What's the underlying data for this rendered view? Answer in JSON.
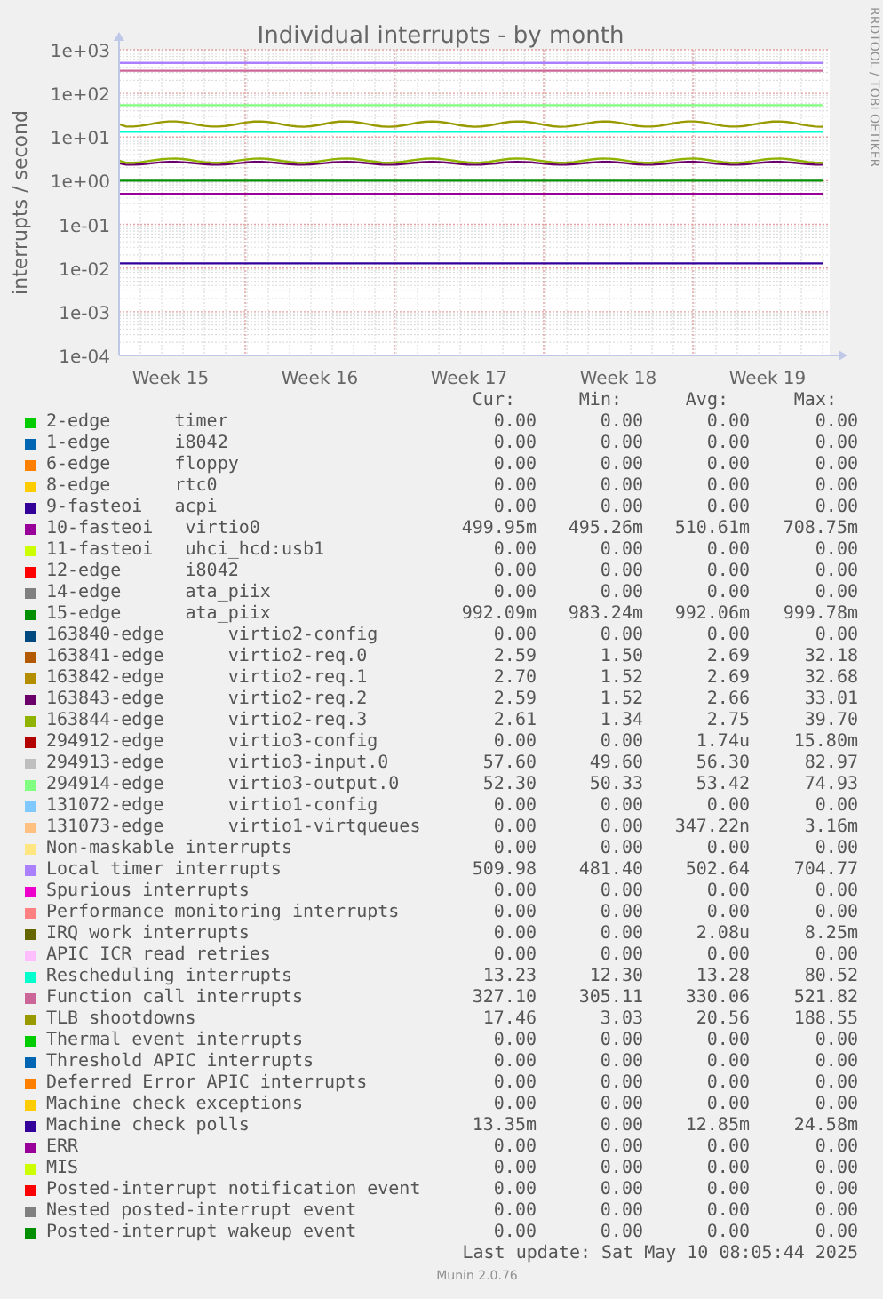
{
  "chart": {
    "side_text": "RRDTOOL / TOBI OETIKER",
    "title": "Individual interrupts - by month",
    "y_axis_label": "interrupts / second",
    "y_tick_labels": [
      "1e+03",
      "1e+02",
      "1e+01",
      "1e+00",
      "1e-01",
      "1e-02",
      "1e-03",
      "1e-04"
    ],
    "x_tick_labels": [
      "Week 15",
      "Week 16",
      "Week 17",
      "Week 18",
      "Week 19"
    ]
  },
  "legend": {
    "header": [
      "Cur:",
      "Min:",
      "Avg:",
      "Max:"
    ],
    "rows": [
      {
        "name": "2-edge      timer",
        "color": "#00cc00",
        "cur": "0.00",
        "min": "0.00",
        "avg": "0.00",
        "max": "0.00"
      },
      {
        "name": "1-edge      i8042",
        "color": "#0066b3",
        "cur": "0.00",
        "min": "0.00",
        "avg": "0.00",
        "max": "0.00"
      },
      {
        "name": "6-edge      floppy",
        "color": "#ff8000",
        "cur": "0.00",
        "min": "0.00",
        "avg": "0.00",
        "max": "0.00"
      },
      {
        "name": "8-edge      rtc0",
        "color": "#ffcc00",
        "cur": "0.00",
        "min": "0.00",
        "avg": "0.00",
        "max": "0.00"
      },
      {
        "name": "9-fasteoi   acpi",
        "color": "#330099",
        "cur": "0.00",
        "min": "0.00",
        "avg": "0.00",
        "max": "0.00"
      },
      {
        "name": "10-fasteoi   virtio0",
        "color": "#990099",
        "cur": "499.95m",
        "min": "495.26m",
        "avg": "510.61m",
        "max": "708.75m"
      },
      {
        "name": "11-fasteoi   uhci_hcd:usb1",
        "color": "#ccff00",
        "cur": "0.00",
        "min": "0.00",
        "avg": "0.00",
        "max": "0.00"
      },
      {
        "name": "12-edge      i8042",
        "color": "#ff0000",
        "cur": "0.00",
        "min": "0.00",
        "avg": "0.00",
        "max": "0.00"
      },
      {
        "name": "14-edge      ata_piix",
        "color": "#808080",
        "cur": "0.00",
        "min": "0.00",
        "avg": "0.00",
        "max": "0.00"
      },
      {
        "name": "15-edge      ata_piix",
        "color": "#008f00",
        "cur": "992.09m",
        "min": "983.24m",
        "avg": "992.06m",
        "max": "999.78m"
      },
      {
        "name": "163840-edge      virtio2-config",
        "color": "#00487d",
        "cur": "0.00",
        "min": "0.00",
        "avg": "0.00",
        "max": "0.00"
      },
      {
        "name": "163841-edge      virtio2-req.0",
        "color": "#b35a00",
        "cur": "2.59",
        "min": "1.50",
        "avg": "2.69",
        "max": "32.18"
      },
      {
        "name": "163842-edge      virtio2-req.1",
        "color": "#b38f00",
        "cur": "2.70",
        "min": "1.52",
        "avg": "2.69",
        "max": "32.68"
      },
      {
        "name": "163843-edge      virtio2-req.2",
        "color": "#6b006b",
        "cur": "2.59",
        "min": "1.52",
        "avg": "2.66",
        "max": "33.01"
      },
      {
        "name": "163844-edge      virtio2-req.3",
        "color": "#8fb300",
        "cur": "2.61",
        "min": "1.34",
        "avg": "2.75",
        "max": "39.70"
      },
      {
        "name": "294912-edge      virtio3-config",
        "color": "#b30000",
        "cur": "0.00",
        "min": "0.00",
        "avg": "1.74u",
        "max": "15.80m"
      },
      {
        "name": "294913-edge      virtio3-input.0",
        "color": "#bebebe",
        "cur": "57.60",
        "min": "49.60",
        "avg": "56.30",
        "max": "82.97"
      },
      {
        "name": "294914-edge      virtio3-output.0",
        "color": "#80ff80",
        "cur": "52.30",
        "min": "50.33",
        "avg": "53.42",
        "max": "74.93"
      },
      {
        "name": "131072-edge      virtio1-config",
        "color": "#80c9ff",
        "cur": "0.00",
        "min": "0.00",
        "avg": "0.00",
        "max": "0.00"
      },
      {
        "name": "131073-edge      virtio1-virtqueues",
        "color": "#ffc080",
        "cur": "0.00",
        "min": "0.00",
        "avg": "347.22n",
        "max": "3.16m"
      },
      {
        "name": "Non-maskable interrupts",
        "color": "#ffe680",
        "cur": "0.00",
        "min": "0.00",
        "avg": "0.00",
        "max": "0.00"
      },
      {
        "name": "Local timer interrupts",
        "color": "#aa80ff",
        "cur": "509.98",
        "min": "481.40",
        "avg": "502.64",
        "max": "704.77"
      },
      {
        "name": "Spurious interrupts",
        "color": "#ee00cc",
        "cur": "0.00",
        "min": "0.00",
        "avg": "0.00",
        "max": "0.00"
      },
      {
        "name": "Performance monitoring interrupts",
        "color": "#ff8080",
        "cur": "0.00",
        "min": "0.00",
        "avg": "0.00",
        "max": "0.00"
      },
      {
        "name": "IRQ work interrupts",
        "color": "#666600",
        "cur": "0.00",
        "min": "0.00",
        "avg": "2.08u",
        "max": "8.25m"
      },
      {
        "name": "APIC ICR read retries",
        "color": "#ffbfff",
        "cur": "0.00",
        "min": "0.00",
        "avg": "0.00",
        "max": "0.00"
      },
      {
        "name": "Rescheduling interrupts",
        "color": "#00ffcc",
        "cur": "13.23",
        "min": "12.30",
        "avg": "13.28",
        "max": "80.52"
      },
      {
        "name": "Function call interrupts",
        "color": "#cc6699",
        "cur": "327.10",
        "min": "305.11",
        "avg": "330.06",
        "max": "521.82"
      },
      {
        "name": "TLB shootdowns",
        "color": "#999900",
        "cur": "17.46",
        "min": "3.03",
        "avg": "20.56",
        "max": "188.55"
      },
      {
        "name": "Thermal event interrupts",
        "color": "#00cc00",
        "cur": "0.00",
        "min": "0.00",
        "avg": "0.00",
        "max": "0.00"
      },
      {
        "name": "Threshold APIC interrupts",
        "color": "#0066b3",
        "cur": "0.00",
        "min": "0.00",
        "avg": "0.00",
        "max": "0.00"
      },
      {
        "name": "Deferred Error APIC interrupts",
        "color": "#ff8000",
        "cur": "0.00",
        "min": "0.00",
        "avg": "0.00",
        "max": "0.00"
      },
      {
        "name": "Machine check exceptions",
        "color": "#ffcc00",
        "cur": "0.00",
        "min": "0.00",
        "avg": "0.00",
        "max": "0.00"
      },
      {
        "name": "Machine check polls",
        "color": "#330099",
        "cur": "13.35m",
        "min": "0.00",
        "avg": "12.85m",
        "max": "24.58m"
      },
      {
        "name": "ERR",
        "color": "#990099",
        "cur": "0.00",
        "min": "0.00",
        "avg": "0.00",
        "max": "0.00"
      },
      {
        "name": "MIS",
        "color": "#ccff00",
        "cur": "0.00",
        "min": "0.00",
        "avg": "0.00",
        "max": "0.00"
      },
      {
        "name": "Posted-interrupt notification event",
        "color": "#ff0000",
        "cur": "0.00",
        "min": "0.00",
        "avg": "0.00",
        "max": "0.00"
      },
      {
        "name": "Nested posted-interrupt event",
        "color": "#808080",
        "cur": "0.00",
        "min": "0.00",
        "avg": "0.00",
        "max": "0.00"
      },
      {
        "name": "Posted-interrupt wakeup event",
        "color": "#008f00",
        "cur": "0.00",
        "min": "0.00",
        "avg": "0.00",
        "max": "0.00"
      }
    ]
  },
  "last_update": "Last update: Sat May 10 08:05:44 2025",
  "version": "Munin 2.0.76"
}
